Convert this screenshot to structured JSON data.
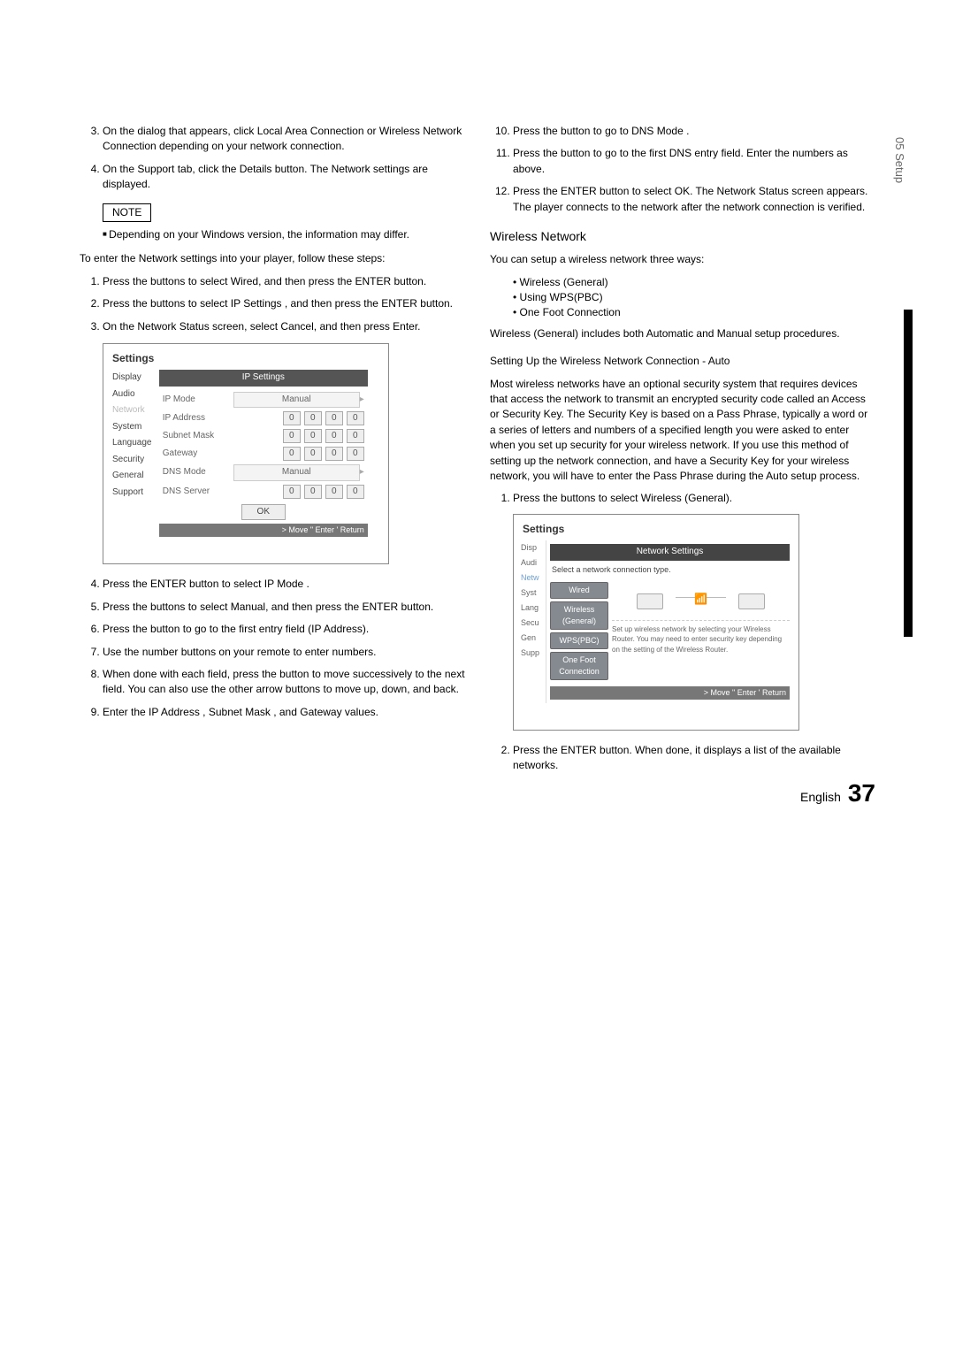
{
  "sideTab": "05  Setup",
  "left": {
    "pre_list": [
      "On the dialog that appears, click Local Area Connection or Wireless Network Connection depending on your network connection.",
      "On the Support tab, click the Details button. The Network settings are displayed."
    ],
    "pre_start": 3,
    "note_label": "NOTE",
    "note_text": "Depending on your Windows version, the information may differ.",
    "intro": "To enter the Network settings into your player, follow these steps:",
    "stepsA": [
      "Press the  buttons to select  Wired, and then press the ENTER button.",
      "Press the  buttons to select  IP Settings , and then press the ENTER button.",
      "On the Network Status screen, select Cancel, and then press Enter."
    ],
    "fig1": {
      "title": "Settings",
      "header": "IP Settings",
      "sidebar": [
        "Display",
        "Audio",
        "Network",
        "System",
        "Language",
        "Security",
        "General",
        "Support"
      ],
      "rows": [
        {
          "lbl": "IP Mode",
          "type": "mode",
          "val": "Manual"
        },
        {
          "lbl": "IP Address",
          "type": "ip",
          "vals": [
            "0",
            "0",
            "0",
            "0"
          ]
        },
        {
          "lbl": "Subnet Mask",
          "type": "ip",
          "vals": [
            "0",
            "0",
            "0",
            "0"
          ]
        },
        {
          "lbl": "Gateway",
          "type": "ip",
          "vals": [
            "0",
            "0",
            "0",
            "0"
          ]
        },
        {
          "lbl": "DNS Mode",
          "type": "mode",
          "val": "Manual"
        },
        {
          "lbl": "DNS Server",
          "type": "ip",
          "vals": [
            "0",
            "0",
            "0",
            "0"
          ]
        }
      ],
      "ok": "OK",
      "hint": "> Move   \"   Enter   '   Return"
    },
    "stepsB_start": 4,
    "stepsB": [
      "Press the ENTER button to select IP Mode .",
      "Press the  buttons to select  Manual, and then press the ENTER button.",
      "Press the  button to go to the first entry field (IP Address).",
      "Use the number buttons on your remote to enter numbers.",
      "When done with each field, press the  button to move successively to the next field. You can also use the other arrow buttons to move up, down, and back.",
      "Enter the IP Address , Subnet Mask , and Gateway values."
    ]
  },
  "right": {
    "stepsC_start": 10,
    "stepsC": [
      "Press the  button to go to  DNS Mode .",
      "Press the  button to go to the first DNS entry field. Enter the numbers as above.",
      "Press the ENTER button to select OK. The Network Status screen appears. The player connects to the network after the network connection is verified."
    ],
    "heading": "Wireless Network",
    "intro": "You can setup a wireless network three ways:",
    "ways": [
      "Wireless (General)",
      "Using WPS(PBC)",
      "One Foot Connection"
    ],
    "note": "Wireless (General) includes both Automatic and Manual setup procedures.",
    "sub": "Setting Up the Wireless Network Connection - Auto",
    "para": "Most wireless networks have an optional security system that requires devices that access the network to transmit an encrypted security code called an Access or Security Key. The Security Key is based on a Pass Phrase, typically a word or a series of letters and numbers of a specified length you were asked to enter when you set up security for your wireless network. If you use this method of setting up the network connection, and have a Security Key for your wireless network, you will have to enter the Pass Phrase during the Auto setup process.",
    "stepsD": [
      "Press the  buttons to select  Wireless (General)."
    ],
    "fig2": {
      "title": "Settings",
      "header": "Network Settings",
      "prompt": "Select a network connection type.",
      "sidebar": [
        "Disp",
        "Audi",
        "Netw",
        "Syst",
        "Lang",
        "Secu",
        "Gen",
        "Supp"
      ],
      "opts": [
        "Wired",
        "Wireless (General)",
        "WPS(PBC)",
        "One Foot Connection"
      ],
      "desc": "Set up wireless network by selecting your Wireless Router. You may need to enter security key depending on the setting of the Wireless Router.",
      "hint": "> Move   \"   Enter   '   Return"
    },
    "stepsE_start": 2,
    "stepsE": [
      "Press the ENTER button. When done, it displays a list of the available networks."
    ]
  },
  "footer": {
    "lang": "English",
    "page": "37"
  }
}
